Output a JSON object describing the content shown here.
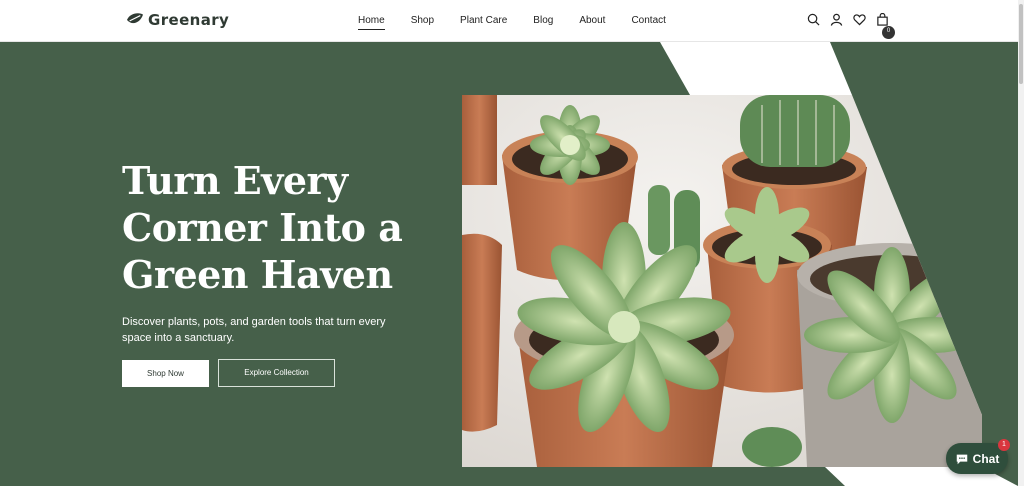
{
  "brand": {
    "name": "Greenary",
    "logo_icon": "leaf-icon"
  },
  "nav": {
    "items": [
      {
        "label": "Home",
        "active": true
      },
      {
        "label": "Shop",
        "active": false
      },
      {
        "label": "Plant Care",
        "active": false
      },
      {
        "label": "Blog",
        "active": false
      },
      {
        "label": "About",
        "active": false
      },
      {
        "label": "Contact",
        "active": false
      }
    ]
  },
  "header_icons": [
    "search-icon",
    "account-icon",
    "heart-icon",
    "cart-icon"
  ],
  "cart": {
    "count": "0"
  },
  "hero": {
    "title": "Turn Every Corner Into a Green Haven",
    "subtitle": "Discover plants, pots, and garden tools that turn every space into a sanctuary.",
    "primary_button": "Shop Now",
    "secondary_button": "Explore Collection"
  },
  "chat": {
    "label": "Chat",
    "badge": "1"
  },
  "colors": {
    "hero_bg": "#46604a",
    "chat_bg": "#2f4e3c",
    "badge_red": "#d9363e"
  }
}
